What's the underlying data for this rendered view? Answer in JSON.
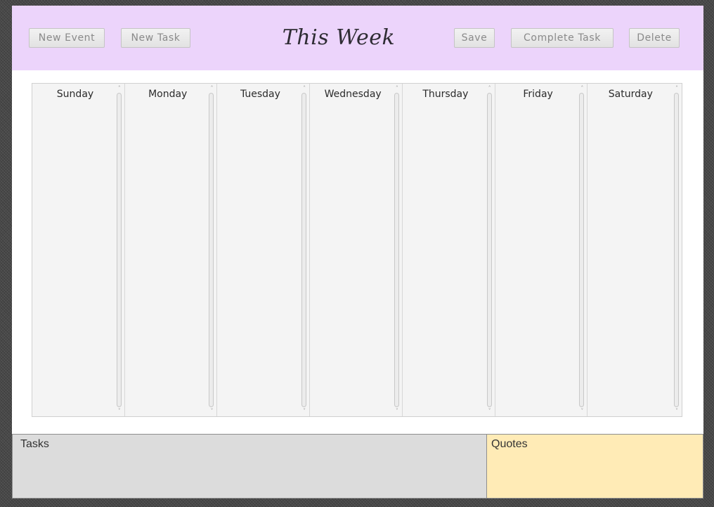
{
  "header": {
    "title": "This Week",
    "new_event_label": "New Event",
    "new_task_label": "New Task",
    "save_label": "Save",
    "complete_task_label": "Complete Task",
    "delete_label": "Delete"
  },
  "week": {
    "days": [
      {
        "label": "Sunday"
      },
      {
        "label": "Monday"
      },
      {
        "label": "Tuesday"
      },
      {
        "label": "Wednesday"
      },
      {
        "label": "Thursday"
      },
      {
        "label": "Friday"
      },
      {
        "label": "Saturday"
      }
    ],
    "scroll_up_glyph": "˄",
    "scroll_down_glyph": "˅"
  },
  "tasks": {
    "label": "Tasks"
  },
  "quotes": {
    "label": "Quotes"
  },
  "colors": {
    "header_bg": "#ecd4fb",
    "tasks_bg": "#dcdcdc",
    "quotes_bg": "#ffebb6",
    "column_bg": "#f4f4f4"
  }
}
